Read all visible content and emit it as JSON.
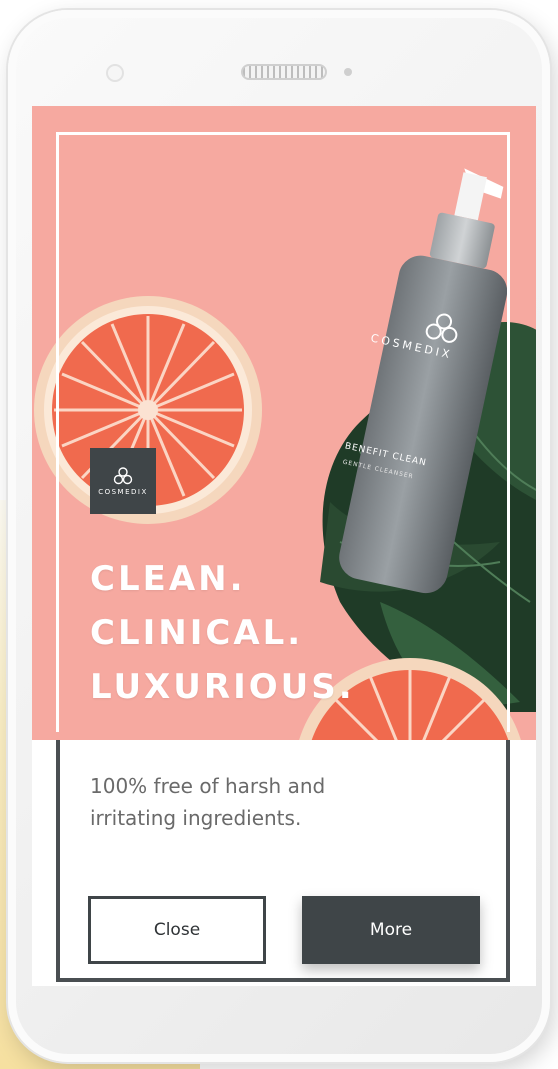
{
  "brand": {
    "logo_text": "COSMEDIX",
    "bottle_brand": "COSMEDIX",
    "bottle_product": "BENEFIT CLEAN",
    "bottle_subtitle": "GENTLE CLEANSER"
  },
  "headline": {
    "line1": "CLEAN.",
    "line2": "CLINICAL.",
    "line3": "LUXURIOUS."
  },
  "tagline": {
    "line1": "100% free of harsh and",
    "line2": "irritating ingredients."
  },
  "actions": {
    "close_label": "Close",
    "more_label": "More"
  },
  "colors": {
    "hero_background": "#f6a9a0",
    "dark_accent": "#3f4548",
    "text_gray": "#6a6a6a"
  }
}
